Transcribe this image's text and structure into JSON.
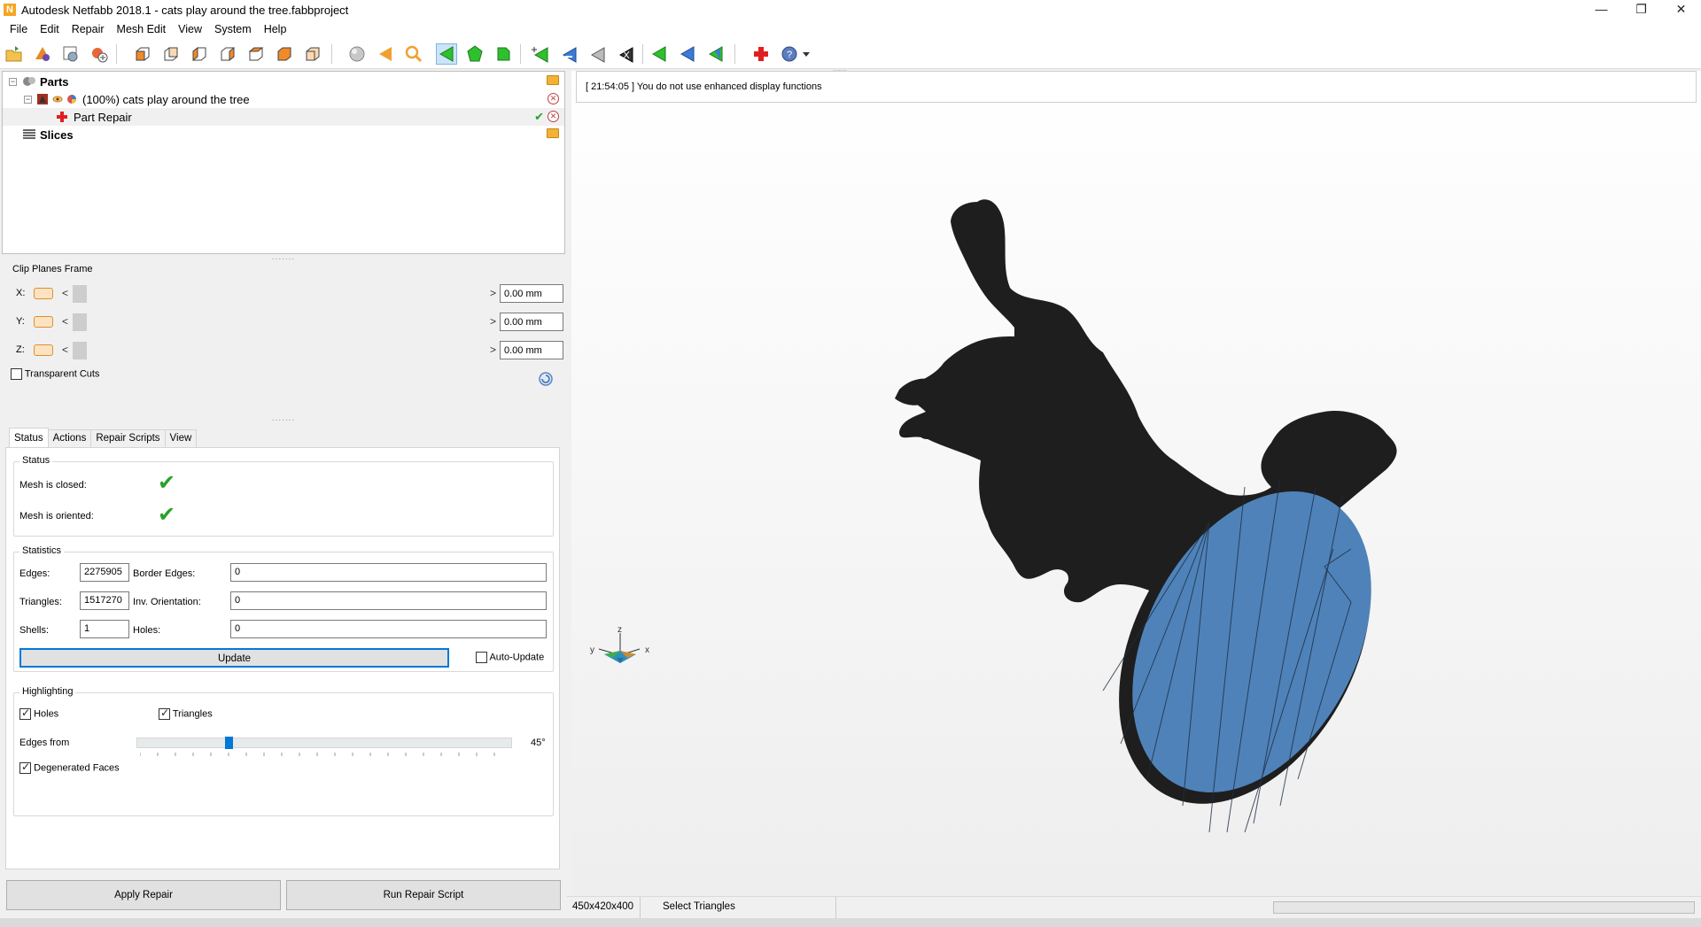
{
  "window": {
    "title": "Autodesk Netfabb 2018.1 - cats play around the tree.fabbproject",
    "app_icon": "N",
    "controls": [
      "minimize-icon",
      "restore-icon",
      "close-icon"
    ]
  },
  "menu": [
    "File",
    "Edit",
    "Repair",
    "Mesh Edit",
    "View",
    "System",
    "Help"
  ],
  "tree": {
    "parts_label": "Parts",
    "part_label": "(100%) cats play around the tree",
    "repair_label": "Part Repair",
    "slices_label": "Slices"
  },
  "clip": {
    "title": "Clip Planes Frame",
    "x_label": "X:",
    "y_label": "Y:",
    "z_label": "Z:",
    "x_value": "0.00 mm",
    "y_value": "0.00 mm",
    "z_value": "0.00 mm",
    "transparent_cuts": "Transparent Cuts"
  },
  "tabs": [
    "Status",
    "Actions",
    "Repair Scripts",
    "View"
  ],
  "status": {
    "title": "Status",
    "closed_label": "Mesh is closed:",
    "oriented_label": "Mesh is oriented:"
  },
  "stats": {
    "title": "Statistics",
    "edges_label": "Edges:",
    "edges_value": "2275905",
    "border_edges_label": "Border Edges:",
    "border_edges_value": "0",
    "triangles_label": "Triangles:",
    "triangles_value": "1517270",
    "inv_orientation_label": "Inv. Orientation:",
    "inv_orientation_value": "0",
    "shells_label": "Shells:",
    "shells_value": "1",
    "holes_label": "Holes:",
    "holes_value": "0",
    "update_button": "Update",
    "auto_update": "Auto-Update"
  },
  "highlighting": {
    "title": "Highlighting",
    "holes": "Holes",
    "triangles": "Triangles",
    "edges_from": "Edges from",
    "angle": "45°",
    "slider_fraction": 0.24,
    "degenerated": "Degenerated Faces"
  },
  "buttons": {
    "apply_repair": "Apply Repair",
    "run_script": "Run Repair Script"
  },
  "log": "[ 21:54:05 ] You do not use enhanced display functions",
  "axes": {
    "z": "z",
    "y": "y",
    "x": "x"
  },
  "statusbar": {
    "dims": "450x420x400",
    "mode": "Select Triangles"
  },
  "colors": {
    "model_silhouette": "#1e1e1e",
    "repair_surface": "#4f82b9",
    "check_green": "#2aa02a"
  }
}
